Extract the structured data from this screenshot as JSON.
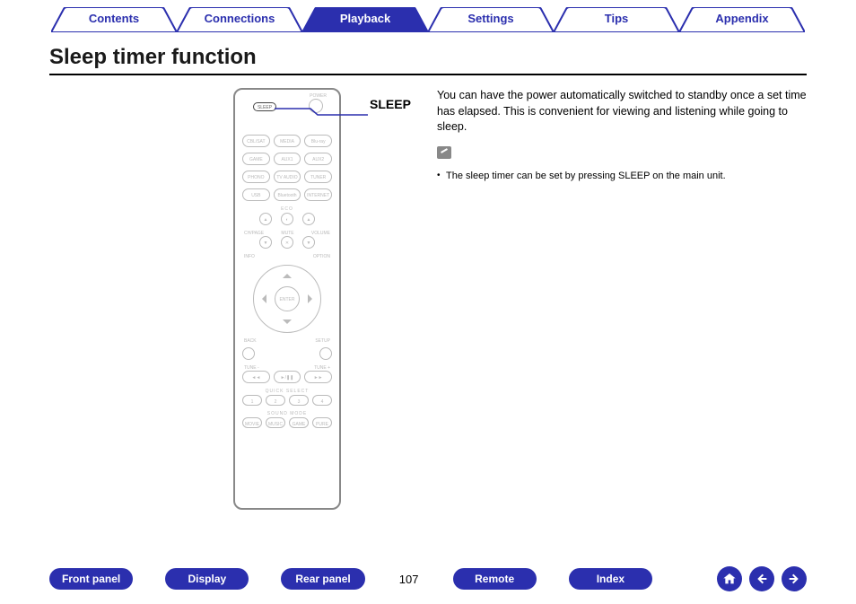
{
  "tabs": {
    "contents": "Contents",
    "connections": "Connections",
    "playback": "Playback",
    "settings": "Settings",
    "tips": "Tips",
    "appendix": "Appendix",
    "active": "playback"
  },
  "title": "Sleep timer function",
  "callout_label": "SLEEP",
  "description": "You can have the power automatically switched to standby once a set time has elapsed. This is convenient for viewing and listening while going to sleep.",
  "note": "The sleep timer can be set by pressing SLEEP on the main unit.",
  "remote": {
    "sleep_label": "SLEEP",
    "power_label": "POWER",
    "sources_row1": [
      "CBL/SAT",
      "MEDIA PLAYER",
      "Blu-ray"
    ],
    "sources_row2": [
      "GAME",
      "AUX1",
      "AUX2"
    ],
    "sources_row3": [
      "PHONO",
      "TV AUDIO",
      "TUNER"
    ],
    "sources_row4": [
      "USB",
      "Bluetooth",
      "INTERNET RADIO"
    ],
    "eco": "ECO",
    "ch_page": "CH/PAGE",
    "mute": "MUTE",
    "volume": "VOLUME",
    "info": "INFO",
    "option": "OPTION",
    "enter": "ENTER",
    "back": "BACK",
    "setup": "SETUP",
    "tune_m": "TUNE -",
    "tune_p": "TUNE +",
    "quick_select": "QUICK SELECT",
    "qs_buttons": [
      "1",
      "2",
      "3",
      "4"
    ],
    "sound_mode": "SOUND MODE",
    "modes": [
      "MOVIE",
      "MUSIC",
      "GAME",
      "PURE"
    ]
  },
  "bottom": {
    "front_panel": "Front panel",
    "display": "Display",
    "rear_panel": "Rear panel",
    "remote": "Remote",
    "index": "Index"
  },
  "page_number": "107"
}
